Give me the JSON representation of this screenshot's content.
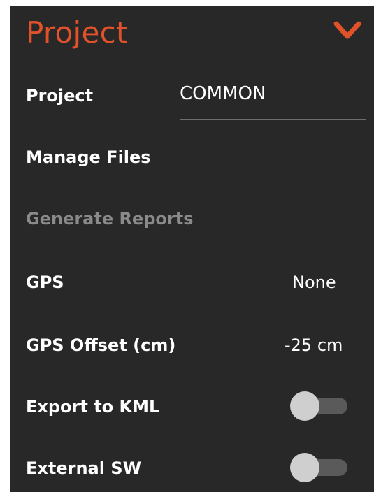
{
  "header": {
    "title": "Project",
    "chevron_icon": "chevron-down-icon",
    "accent_color": "#e2522a"
  },
  "rows": {
    "project": {
      "label": "Project",
      "value": "COMMON"
    },
    "manage_files": {
      "label": "Manage Files"
    },
    "generate_reports": {
      "label": "Generate Reports",
      "disabled": true
    },
    "gps": {
      "label": "GPS",
      "value": "None"
    },
    "gps_offset": {
      "label": "GPS Offset (cm)",
      "value": "-25 cm"
    },
    "export_kml": {
      "label": "Export to KML",
      "toggle_on": false
    },
    "external_sw": {
      "label": "External SW",
      "toggle_on": false
    }
  }
}
